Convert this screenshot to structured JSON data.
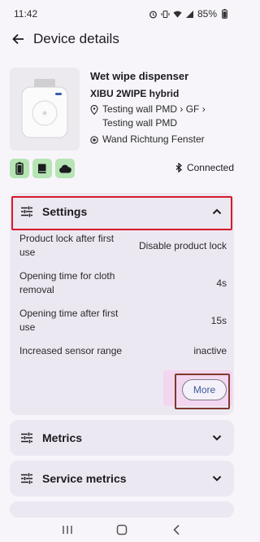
{
  "status_bar": {
    "time": "11:42",
    "battery": "85%",
    "icons": [
      "alarm-icon",
      "vibrate-icon",
      "wifi-icon",
      "signal-icon",
      "battery-icon"
    ]
  },
  "app_bar": {
    "title": "Device details",
    "back_icon": "arrow-back-icon"
  },
  "device": {
    "name": "Wet wipe dispenser",
    "model": "XIBU 2WIPE hybrid",
    "location_line1": "Testing wall PMD › GF ›",
    "location_line2": "Testing wall  PMD",
    "position": "Wand Richtung Fenster",
    "status_icons": [
      "battery-icon",
      "book-icon",
      "cloud-icon"
    ],
    "status_color": "#b6e4b4",
    "connection_status": "Connected"
  },
  "settings": {
    "title": "Settings",
    "rows": [
      {
        "label": "Product lock after first use",
        "value": "Disable product lock"
      },
      {
        "label": "Opening time for cloth removal",
        "value": "4s"
      },
      {
        "label": "Opening time after first use",
        "value": "15s"
      },
      {
        "label": "Increased sensor range",
        "value": "inactive"
      }
    ],
    "more_label": "More"
  },
  "sections": [
    {
      "title": "Metrics"
    },
    {
      "title": "Service metrics"
    }
  ],
  "colors": {
    "card_bg": "#ece8f2",
    "highlight_red": "#d5192a",
    "highlight_brown": "#7c3a2e",
    "more_text": "#3d5a9a"
  }
}
